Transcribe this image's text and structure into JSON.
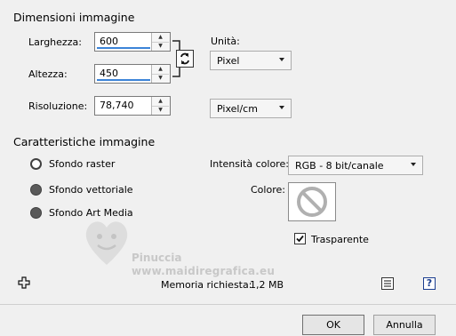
{
  "dimensions": {
    "title": "Dimensioni immagine",
    "width_label": "Larghezza:",
    "width_value": "600",
    "height_label": "Altezza:",
    "height_value": "450",
    "resolution_label": "Risoluzione:",
    "resolution_value": "78,740",
    "units_label": "Unità:",
    "units_value": "Pixel",
    "resolution_units_value": "Pixel/cm"
  },
  "characteristics": {
    "title": "Caratteristiche immagine",
    "radio_raster": "Sfondo raster",
    "radio_vector": "Sfondo vettoriale",
    "radio_art_media": "Sfondo Art Media",
    "selected": "raster",
    "color_depth_label": "Intensità colore:",
    "color_depth_value": "RGB - 8 bit/canale",
    "color_label": "Colore:",
    "transparent_label": "Trasparente",
    "transparent_checked": true
  },
  "watermark": {
    "line1": "Pinuccia",
    "line2": "www.maidiregrafica.eu"
  },
  "footer": {
    "memory_label": "Memoria richiesta:",
    "memory_value": "1,2 MB",
    "ok_label": "OK",
    "cancel_label": "Annulla"
  },
  "icons": {
    "link": "link-toggle-icon",
    "move": "move-cross-icon",
    "preset": "preset-list-icon",
    "help": "help-icon",
    "no_color": "no-color-icon"
  }
}
